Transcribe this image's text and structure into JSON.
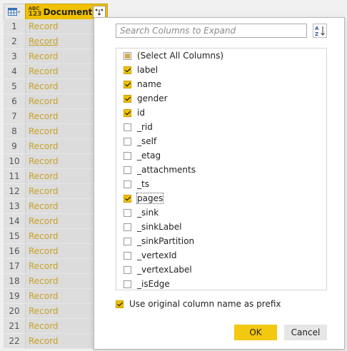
{
  "grid": {
    "column_type_badge_top": "ABC",
    "column_type_badge_bottom": "123",
    "column_title": "Document",
    "rows": [
      {
        "num": "1",
        "value": "Record"
      },
      {
        "num": "2",
        "value": "Record"
      },
      {
        "num": "3",
        "value": "Record"
      },
      {
        "num": "4",
        "value": "Record"
      },
      {
        "num": "5",
        "value": "Record"
      },
      {
        "num": "6",
        "value": "Record"
      },
      {
        "num": "7",
        "value": "Record"
      },
      {
        "num": "8",
        "value": "Record"
      },
      {
        "num": "9",
        "value": "Record"
      },
      {
        "num": "10",
        "value": "Record"
      },
      {
        "num": "11",
        "value": "Record"
      },
      {
        "num": "12",
        "value": "Record"
      },
      {
        "num": "13",
        "value": "Record"
      },
      {
        "num": "14",
        "value": "Record"
      },
      {
        "num": "15",
        "value": "Record"
      },
      {
        "num": "16",
        "value": "Record"
      },
      {
        "num": "17",
        "value": "Record"
      },
      {
        "num": "18",
        "value": "Record"
      },
      {
        "num": "19",
        "value": "Record"
      },
      {
        "num": "20",
        "value": "Record"
      },
      {
        "num": "21",
        "value": "Record"
      },
      {
        "num": "22",
        "value": "Record"
      }
    ]
  },
  "expand_panel": {
    "search_placeholder": "Search Columns to Expand",
    "select_all_label": "(Select All Columns)",
    "columns": [
      {
        "label": "label",
        "checked": true
      },
      {
        "label": "name",
        "checked": true
      },
      {
        "label": "gender",
        "checked": true
      },
      {
        "label": "id",
        "checked": true
      },
      {
        "label": "_rid",
        "checked": false
      },
      {
        "label": "_self",
        "checked": false
      },
      {
        "label": "_etag",
        "checked": false
      },
      {
        "label": "_attachments",
        "checked": false
      },
      {
        "label": "_ts",
        "checked": false
      },
      {
        "label": "pages",
        "checked": true
      },
      {
        "label": "_sink",
        "checked": false
      },
      {
        "label": "_sinkLabel",
        "checked": false
      },
      {
        "label": "_sinkPartition",
        "checked": false
      },
      {
        "label": "_vertexId",
        "checked": false
      },
      {
        "label": "_vertexLabel",
        "checked": false
      },
      {
        "label": "_isEdge",
        "checked": false
      }
    ],
    "prefix_label": "Use original column name as prefix",
    "prefix_checked": true,
    "ok_label": "OK",
    "cancel_label": "Cancel"
  },
  "colors": {
    "accent": "#f0c000",
    "record_link": "#c9a227"
  },
  "icons": {
    "table_corner": "table-icon",
    "expand": "expand-columns-icon",
    "sort": "sort-az-icon"
  }
}
